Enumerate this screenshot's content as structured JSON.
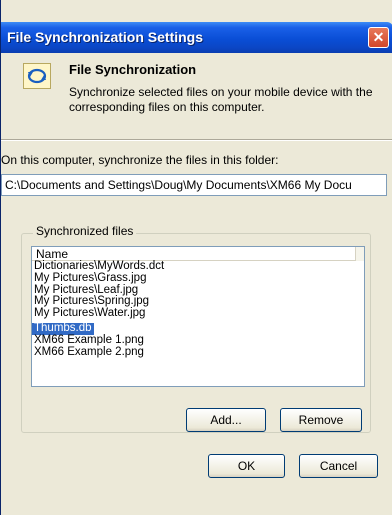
{
  "window": {
    "title": "File Synchronization Settings",
    "close_glyph": "✕"
  },
  "header": {
    "icon": "sync-icon",
    "title": "File Synchronization",
    "description": "Synchronize selected files on your mobile device with the corresponding files on this computer."
  },
  "folder": {
    "label": "On this computer, synchronize the files in this folder:",
    "path": "C:\\Documents and Settings\\Doug\\My Documents\\XM66 My Docu"
  },
  "synced": {
    "group_label": "Synchronized files",
    "column_header": "Name",
    "items": [
      "Dictionaries\\MyWords.dct",
      "My Pictures\\Grass.jpg",
      "My Pictures\\Leaf.jpg",
      "My Pictures\\Spring.jpg",
      "My Pictures\\Water.jpg",
      "Thumbs.db",
      "XM66 Example 1.png",
      "XM66 Example 2.png"
    ],
    "selected": "Thumbs.db"
  },
  "buttons": {
    "add": "Add...",
    "remove": "Remove",
    "ok": "OK",
    "cancel": "Cancel"
  },
  "colors": {
    "titlebar": "#0a4ed6",
    "selection": "#316ac5",
    "dialog": "#ece9d8"
  }
}
